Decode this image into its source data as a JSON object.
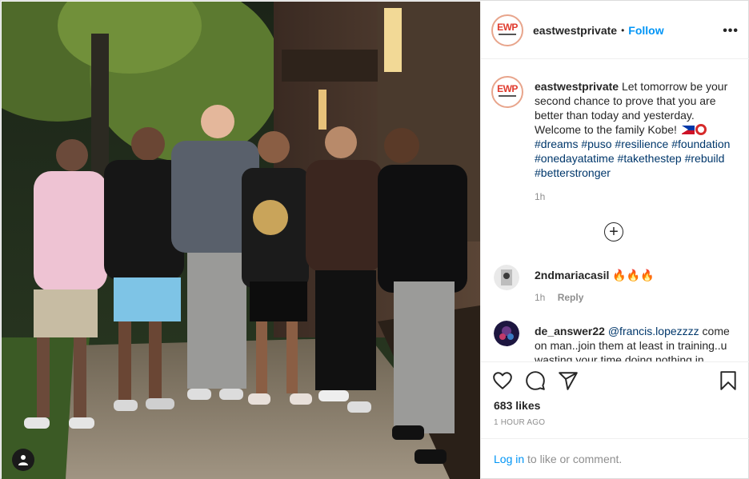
{
  "header": {
    "avatar_logo": "EWP",
    "username": "eastwestprivate",
    "separator": "•",
    "follow_label": "Follow",
    "more_label": "•••"
  },
  "caption": {
    "username": "eastwestprivate",
    "text": "Let tomorrow be your second chance to prove that you are better than today and yesterday. Welcome to the family Kobe!",
    "hashtags": [
      "#dreams",
      "#puso",
      "#resilience",
      "#foundation",
      "#onedayatatime",
      "#takethestep",
      "#rebuild",
      "#betterstronger"
    ],
    "time": "1h"
  },
  "load_more_label": "+",
  "comments": [
    {
      "username": "2ndmariacasil",
      "text": "🔥🔥🔥",
      "time": "1h",
      "reply_label": "Reply"
    },
    {
      "username": "de_answer22",
      "mention": "@francis.lopezzzz",
      "text": "come on man..join them at least in training..u wasting your time doing nothing in"
    }
  ],
  "actions": {
    "like_icon": "heart-icon",
    "comment_icon": "comment-icon",
    "share_icon": "paper-plane-icon",
    "save_icon": "bookmark-icon",
    "likes": "683 likes",
    "posted_ago": "1 HOUR AGO"
  },
  "comment_bar": {
    "login_label": "Log in",
    "rest": "to like or comment."
  },
  "photo": {
    "user_tag_icon": "person-icon"
  }
}
